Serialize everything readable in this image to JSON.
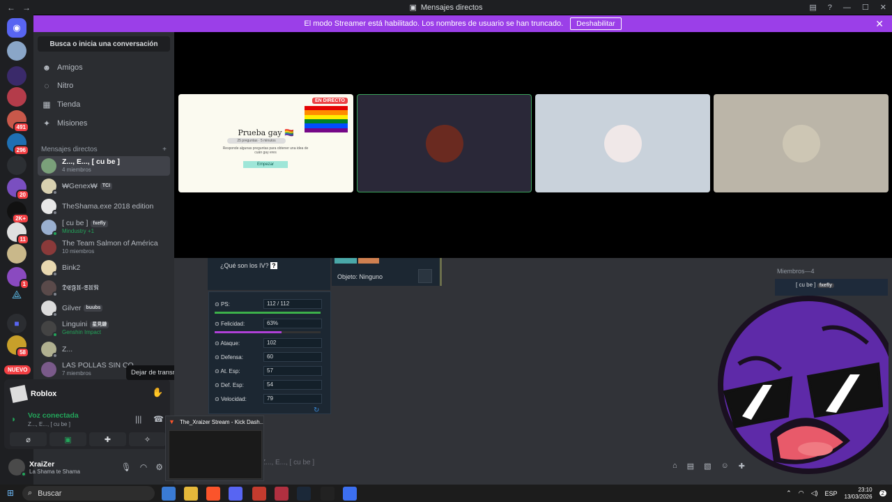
{
  "window": {
    "title": "Mensajes directos"
  },
  "banner": {
    "text": "El modo Streamer está habilitado. Los nombres de usuario se han truncado.",
    "button": "Deshabilitar"
  },
  "rail": {
    "badges": [
      "491",
      "296",
      "20",
      "2K+",
      "11",
      "1",
      "58"
    ],
    "new_label": "NUEVO"
  },
  "dm_panel": {
    "search": "Busca o inicia una conversación",
    "nav": [
      "Amigos",
      "Nitro",
      "Tienda",
      "Misiones"
    ],
    "section": "Mensajes directos",
    "items": [
      {
        "name": "Z..., E..., [ cu be ]",
        "sub": "4 miembros",
        "tag": ""
      },
      {
        "name": "₩Genex₩",
        "sub": "",
        "tag": "TCI"
      },
      {
        "name": "TheShama.exe 2018 edition",
        "sub": "",
        "tag": ""
      },
      {
        "name": "[ cu be ]",
        "sub": "Mindustry +1",
        "tag": "fxefly"
      },
      {
        "name": "The Team Salmon of América",
        "sub": "10 miembros",
        "tag": ""
      },
      {
        "name": "Bink2",
        "sub": "",
        "tag": ""
      },
      {
        "name": "𝕯𝕰𝕱𝖀-𝕾𝖀𝕹",
        "sub": "",
        "tag": ""
      },
      {
        "name": "Gilver",
        "sub": "",
        "tag": "buubs"
      },
      {
        "name": "Linguini",
        "sub": "Genshin Impact",
        "tag": "星見鎌"
      },
      {
        "name": "Z...",
        "sub": "",
        "tag": ""
      },
      {
        "name": "LAS POLLAS SIN CO",
        "sub": "7 miembros",
        "tag": ""
      }
    ]
  },
  "voice": {
    "app": "Roblox",
    "tooltip": "Dejar de transmitir",
    "status": "Voz conectada",
    "channel": "Z..., E..., [ cu be ]"
  },
  "user": {
    "name": "XraiZer",
    "status": "La Shama te Shama"
  },
  "stream": {
    "live": "EN DIRECTO",
    "quiz_title": "Prueba gay 🏳️‍🌈",
    "quiz_pill": "25 preguntas · 5 minutos",
    "quiz_sub": "Responde algunas preguntas para obtener una idea de cuán gay eres",
    "quiz_button": "Empezar"
  },
  "stats": {
    "question": "¿Qué son los IV?",
    "object": "Objeto: Ninguno",
    "rows": [
      {
        "label": "PS:",
        "value": "112 / 112"
      },
      {
        "label": "Felicidad:",
        "value": "63%"
      },
      {
        "label": "Ataque:",
        "value": "102"
      },
      {
        "label": "Defensa:",
        "value": "60"
      },
      {
        "label": "At. Esp:",
        "value": "57"
      },
      {
        "label": "Def. Esp:",
        "value": "54"
      },
      {
        "label": "Velocidad:",
        "value": "79"
      }
    ],
    "hp_fraction": 1.0,
    "happiness_fraction": 0.63
  },
  "members_header": "Miembros—4",
  "member_preview": "[ cu be ]",
  "message_placeholder": "Z..., E..., [ cu be ]",
  "taskbar_thumb": "The_Xraizer Stream - Kick Dash...",
  "taskbar": {
    "search": "Buscar",
    "lang": "ESP",
    "time": "23:10",
    "date": "13/03/2026",
    "notif": "2"
  },
  "colors": {
    "streamer_banner": "#9b3fe8",
    "voice_green": "#23a55a",
    "badge_red": "#f23f43"
  }
}
